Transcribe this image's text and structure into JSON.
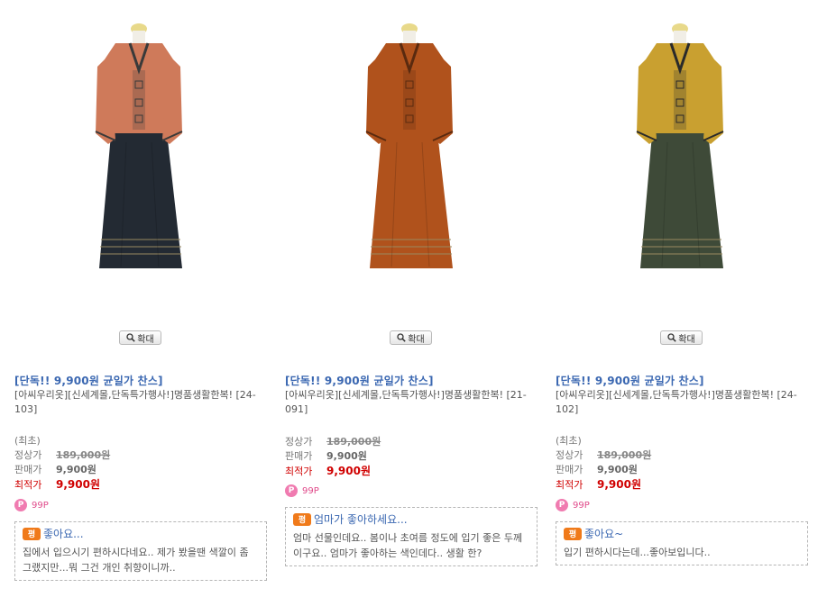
{
  "products": [
    {
      "promo": "[단독!! 9,900원 균일가 찬스]",
      "name": "[아씨우리옷][신세계몰,단독특가행사!]명품생활한복! [24-103]",
      "first_label": "(최초)",
      "regular_label": "정상가",
      "regular_price": "189,000원",
      "sale_label": "판매가",
      "sale_price": "9,900원",
      "best_label": "최적가",
      "best_price": "9,900원",
      "points": "99P",
      "zoom_label": "확대",
      "review_badge": "평",
      "review_title": "좋아요...",
      "review_body": "집에서 입으시기 편하시다네요.. 제가 봤을땐 색깔이 좀 그랬지만...뭐 그건 개인 취향이니까..",
      "colors": {
        "jacket": "#cf7a5a",
        "skirt": "#232a33",
        "trim": "#3a3a3a"
      }
    },
    {
      "promo": "[단독!! 9,900원 균일가 찬스]",
      "name": "[아씨우리옷][신세계몰,단독특가행사!]명품생활한복! [21-091]",
      "first_label": "",
      "regular_label": "정상가",
      "regular_price": "189,000원",
      "sale_label": "판매가",
      "sale_price": "9,900원",
      "best_label": "최적가",
      "best_price": "9,900원",
      "points": "99P",
      "zoom_label": "확대",
      "review_badge": "평",
      "review_title": "엄마가 좋아하세요...",
      "review_body": "엄마 선물인데요.. 봄이나 초여름 정도에 입기 좋은 두께이구요.. 엄마가 좋아하는 색인데다.. 생활 한?",
      "colors": {
        "jacket": "#b0521c",
        "skirt": "#b0521c",
        "trim": "#5a2a0f"
      }
    },
    {
      "promo": "[단독!! 9,900원 균일가 찬스]",
      "name": "[아씨우리옷][신세계몰,단독특가행사!]명품생활한복! [24-102]",
      "first_label": "(최초)",
      "regular_label": "정상가",
      "regular_price": "189,000원",
      "sale_label": "판매가",
      "sale_price": "9,900원",
      "best_label": "최적가",
      "best_price": "9,900원",
      "points": "99P",
      "zoom_label": "확대",
      "review_badge": "평",
      "review_title": "좋아요~",
      "review_body": "입기 편하시다는데...좋아보입니다..",
      "colors": {
        "jacket": "#c9a030",
        "skirt": "#3e4a38",
        "trim": "#2a2a2a"
      }
    }
  ]
}
